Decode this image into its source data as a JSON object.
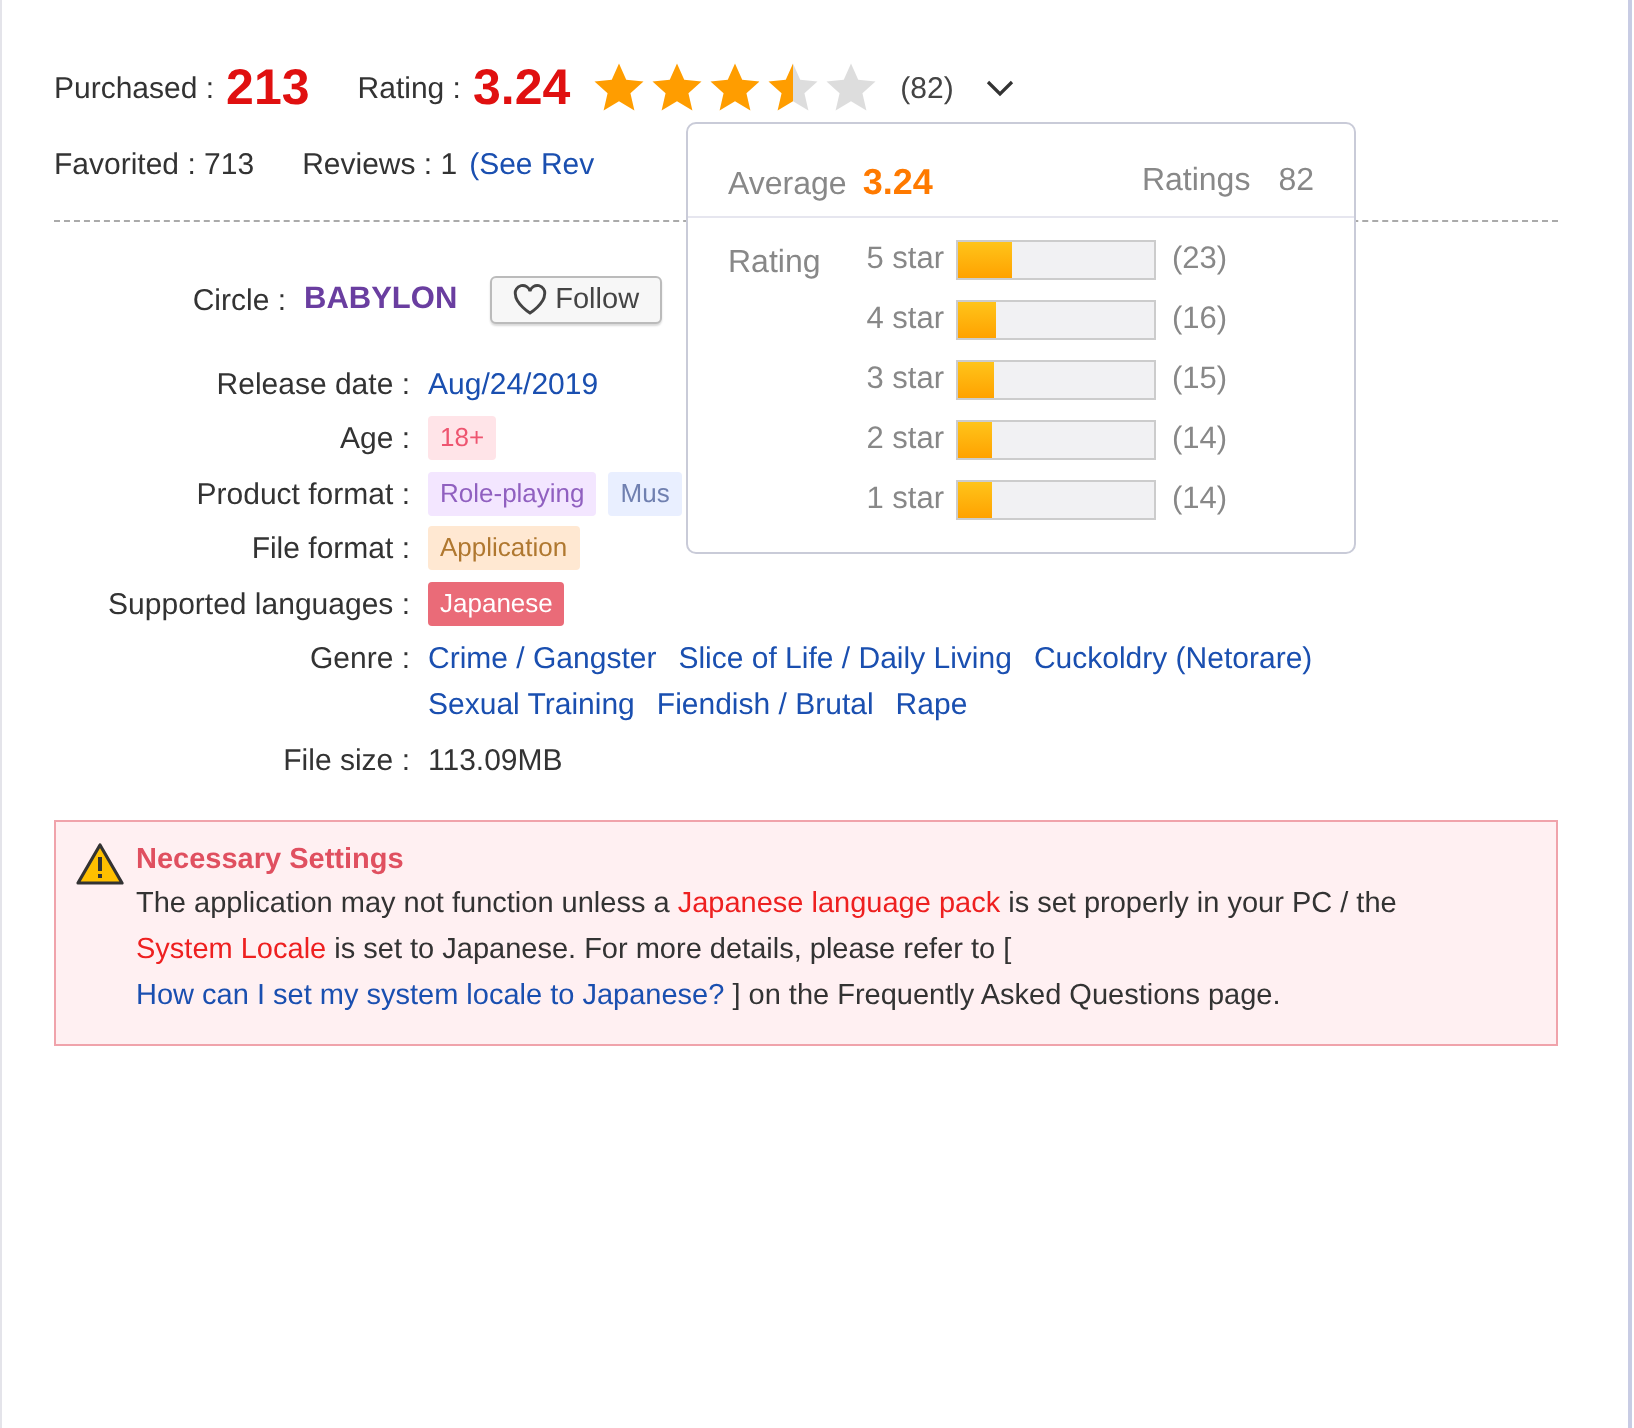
{
  "stats": {
    "purchased_label": "Purchased :",
    "purchased": "213",
    "rating_label": "Rating :",
    "rating": "3.24",
    "stars": 3.5,
    "rating_count": "(82)",
    "favorited": "Favorited : 713",
    "reviews_label": "Reviews : 1",
    "reviews_link": "(See Rev"
  },
  "popup": {
    "average_label": "Average",
    "average": "3.24",
    "ratings_label": "Ratings",
    "ratings": "82",
    "rating_label": "Rating",
    "rows": [
      {
        "label": "5 star",
        "level": 0.28,
        "count": "(23)"
      },
      {
        "label": "4 star",
        "level": 0.195,
        "count": "(16)"
      },
      {
        "label": "3 star",
        "level": 0.183,
        "count": "(15)"
      },
      {
        "label": "2 star",
        "level": 0.17,
        "count": "(14)"
      },
      {
        "label": "1 star",
        "level": 0.17,
        "count": "(14)"
      }
    ]
  },
  "details": [
    {
      "kind": "circle",
      "label": "Circle :",
      "value": "BABYLON",
      "button": "Follow"
    },
    {
      "kind": "link",
      "label": "Release date :",
      "values": [
        "Aug/24/2019"
      ]
    },
    {
      "kind": "tags",
      "label": "Age :",
      "tags": [
        {
          "text": "18+",
          "color": "#ffe4e8"
        }
      ]
    },
    {
      "kind": "tags",
      "label": "Product format :",
      "tags": [
        {
          "text": "Role-playing",
          "color": "#f3e6ff"
        },
        {
          "text": "Mus",
          "color": "#e9efff"
        }
      ]
    },
    {
      "kind": "tags",
      "label": "File format :",
      "tags": [
        {
          "text": "Application",
          "color": "#ffe8d2"
        }
      ]
    },
    {
      "kind": "tags",
      "label": "Supported languages :",
      "tags": [
        {
          "text": "Japanese",
          "color": "#ea6b78"
        }
      ]
    },
    {
      "kind": "link",
      "label": "Genre :",
      "values": [
        "Crime / Gangster",
        "Slice of Life / Daily Living",
        "Cuckoldry (Netorare)",
        "Sexual Training",
        "Fiendish / Brutal",
        "Rape"
      ]
    },
    {
      "kind": "text",
      "label": "File size :",
      "values": [
        "113.09MB"
      ]
    }
  ],
  "notice": {
    "title": "Necessary Settings",
    "segments": [
      {
        "kind": "text",
        "text": "The application may not function unless a "
      },
      {
        "kind": "highlight",
        "text": "Japanese language pack"
      },
      {
        "kind": "text",
        "text": " is set properly in your PC / the "
      },
      {
        "kind": "highlight",
        "text": "System Locale"
      },
      {
        "kind": "text",
        "text": " is set to Japanese. For more details, please refer to [ "
      },
      {
        "kind": "link",
        "text": "How can I set my system locale to Japanese?"
      },
      {
        "kind": "text",
        "text": " ] on the Frequently Asked Questions page."
      }
    ]
  }
}
